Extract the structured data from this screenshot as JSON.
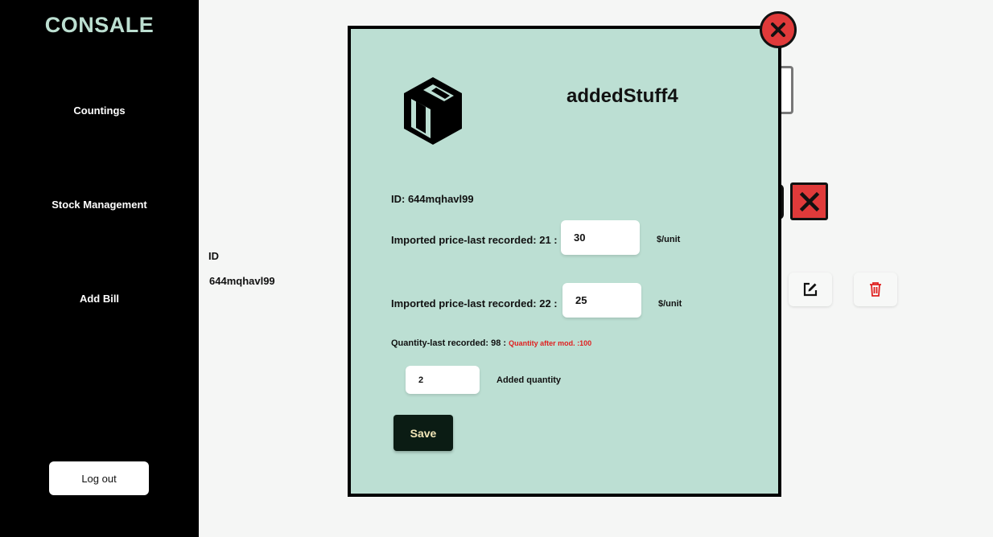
{
  "app": {
    "brand": "CONSALE"
  },
  "sidebar": {
    "items": [
      {
        "label": "Countings"
      },
      {
        "label": "Stock Management"
      },
      {
        "label": "Add Bill"
      }
    ],
    "logout_label": "Log out"
  },
  "background": {
    "id_header": "ID",
    "id_value": "644mqhavl99"
  },
  "modal": {
    "product_name": "addedStuff4",
    "id_line": "ID: 644mqhavl99",
    "price1": {
      "label": "Imported price-last recorded: 21 :",
      "value": "30",
      "unit": "$/unit"
    },
    "price2": {
      "label": "Imported price-last recorded: 22 :",
      "value": "25",
      "unit": "$/unit"
    },
    "quantity_label": "Quantity-last recorded: 98 :",
    "quantity_after_note": "Quantity after mod. :100",
    "added_quantity": {
      "value": "2",
      "label": "Added quantity"
    },
    "save_label": "Save"
  },
  "colors": {
    "sidebar_bg": "#000000",
    "brand": "#bcdfd1",
    "modal_bg": "#bcdfd3",
    "danger": "#e03a3a",
    "note_red": "#e02020",
    "save_bg": "#0b1c14",
    "save_text": "#f2e6b8"
  },
  "icons": {
    "modal_close": "close-circle-icon",
    "product": "package-box-icon",
    "clear": "close-x-icon",
    "edit": "edit-icon",
    "delete": "trash-icon"
  }
}
